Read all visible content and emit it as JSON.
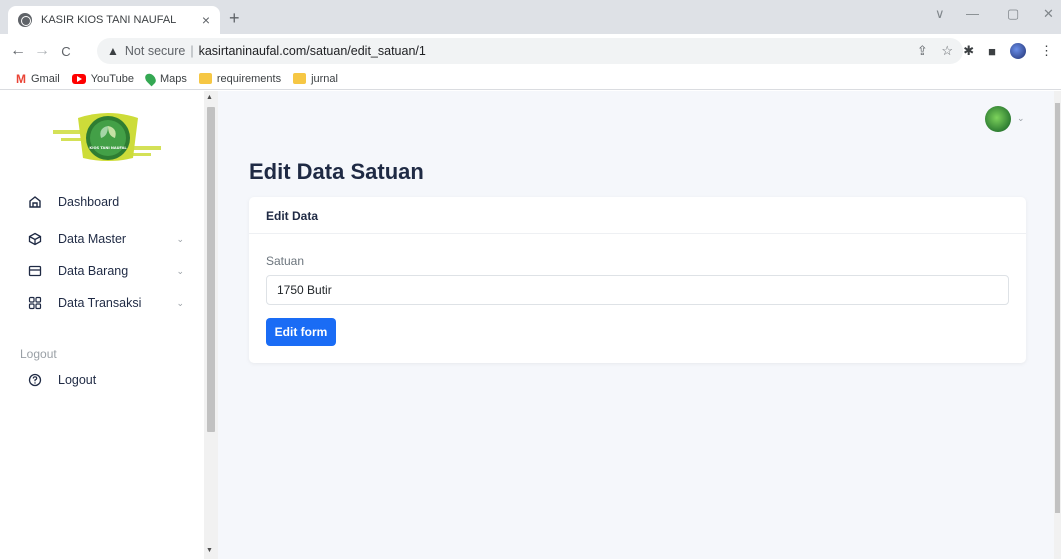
{
  "browser": {
    "tab_title": "KASIR KIOS TANI NAUFAL",
    "tab_close": "×",
    "new_tab": "+",
    "window_controls": [
      "∨",
      "—",
      "▢",
      "✕"
    ],
    "nav": {
      "back": "←",
      "forward": "→",
      "reload": "C"
    },
    "address": {
      "warning": "Not secure",
      "separator": "|",
      "url": "kasirtaninaufal.com/satuan/edit_satuan/1"
    },
    "bookmarks": [
      {
        "label": "Gmail",
        "icon": "gmail-icon"
      },
      {
        "label": "YouTube",
        "icon": "youtube-icon"
      },
      {
        "label": "Maps",
        "icon": "maps-icon"
      },
      {
        "label": "requirements",
        "icon": "folder-icon"
      },
      {
        "label": "jurnal",
        "icon": "folder-icon"
      }
    ]
  },
  "sidebar": {
    "logo_text": "KIOS TANI NAUFAL",
    "items": [
      {
        "label": "Dashboard",
        "icon": "home-icon",
        "has_chevron": false
      },
      {
        "label": "Data Master",
        "icon": "box-icon",
        "has_chevron": true
      },
      {
        "label": "Data Barang",
        "icon": "card-icon",
        "has_chevron": true
      },
      {
        "label": "Data Transaksi",
        "icon": "grid-icon",
        "has_chevron": true
      }
    ],
    "section_label": "Logout",
    "logout_label": "Logout"
  },
  "main": {
    "page_title": "Edit Data Satuan",
    "card_header": "Edit Data",
    "field_label": "Satuan",
    "field_value": "1750 Butir",
    "submit_label": "Edit form"
  },
  "colors": {
    "primary": "#1a6cf5",
    "title": "#1f2a44",
    "background": "#f5f7fb",
    "logo_green": "#4caf50",
    "logo_yellow": "#d4e157"
  }
}
